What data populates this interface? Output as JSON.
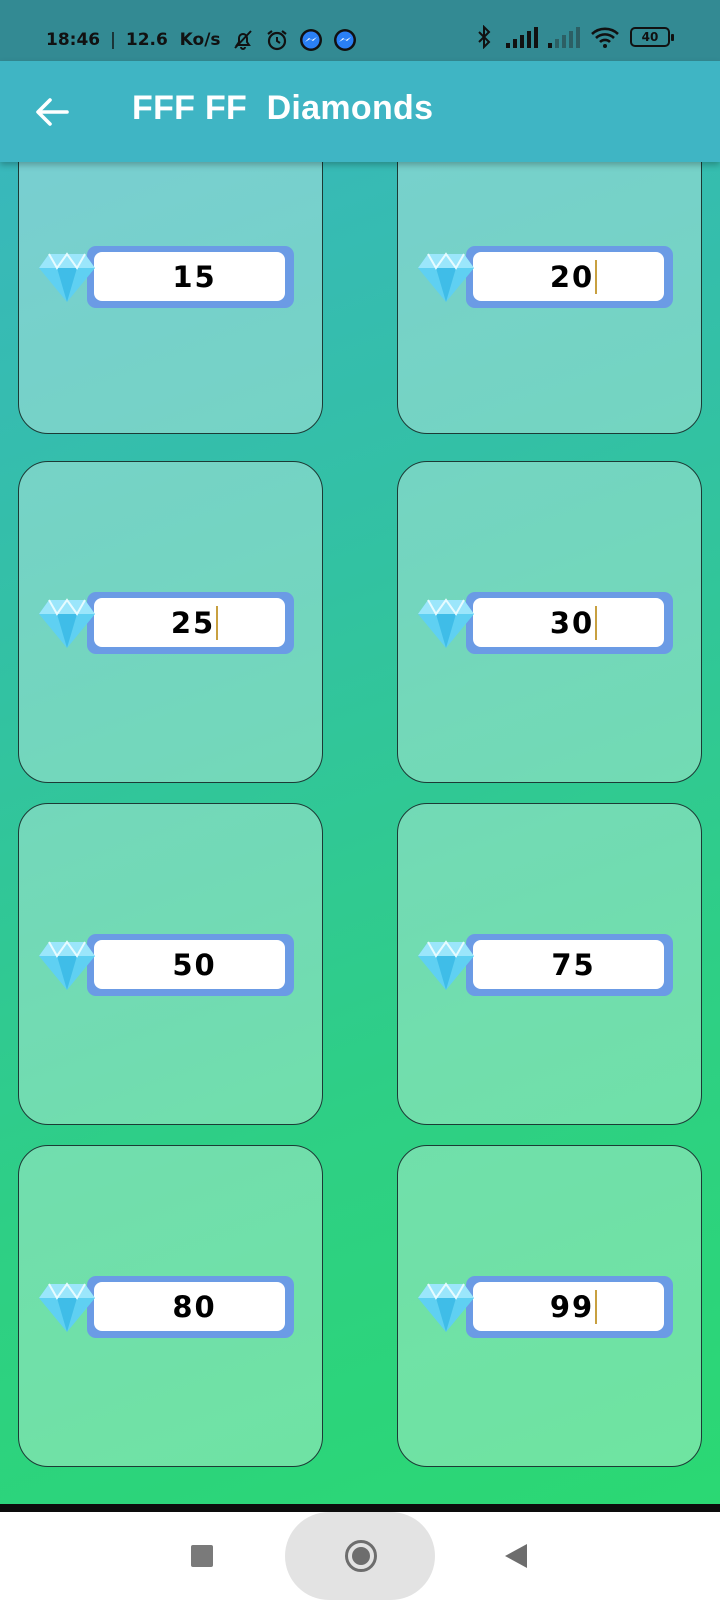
{
  "status_bar": {
    "time": "18:46",
    "separator": "|",
    "speed": "12.6  Ko/s",
    "battery": "40",
    "icons": [
      "bell-off-icon",
      "alarm-icon",
      "messenger-icon",
      "messenger-icon",
      "bluetooth-icon",
      "signal-icon",
      "signal-icon",
      "wifi-icon",
      "battery-icon"
    ]
  },
  "app_bar": {
    "title": "FFF FF  Diamonds",
    "back_icon": "arrow-left-icon"
  },
  "cards": [
    {
      "value": "15",
      "cursor": false
    },
    {
      "value": "20",
      "cursor": true
    },
    {
      "value": "25",
      "cursor": true
    },
    {
      "value": "30",
      "cursor": true
    },
    {
      "value": "50",
      "cursor": false
    },
    {
      "value": "75",
      "cursor": false
    },
    {
      "value": "80",
      "cursor": false
    },
    {
      "value": "99",
      "cursor": true
    }
  ],
  "colors": {
    "app_bar": "#3fb5c4",
    "status_bar": "#338a93",
    "badge_border": "#6b9be5",
    "diamond": "#5fd0f2"
  },
  "nav_bar": {
    "icons": [
      "recent-apps-icon",
      "home-icon",
      "back-triangle-icon"
    ]
  }
}
